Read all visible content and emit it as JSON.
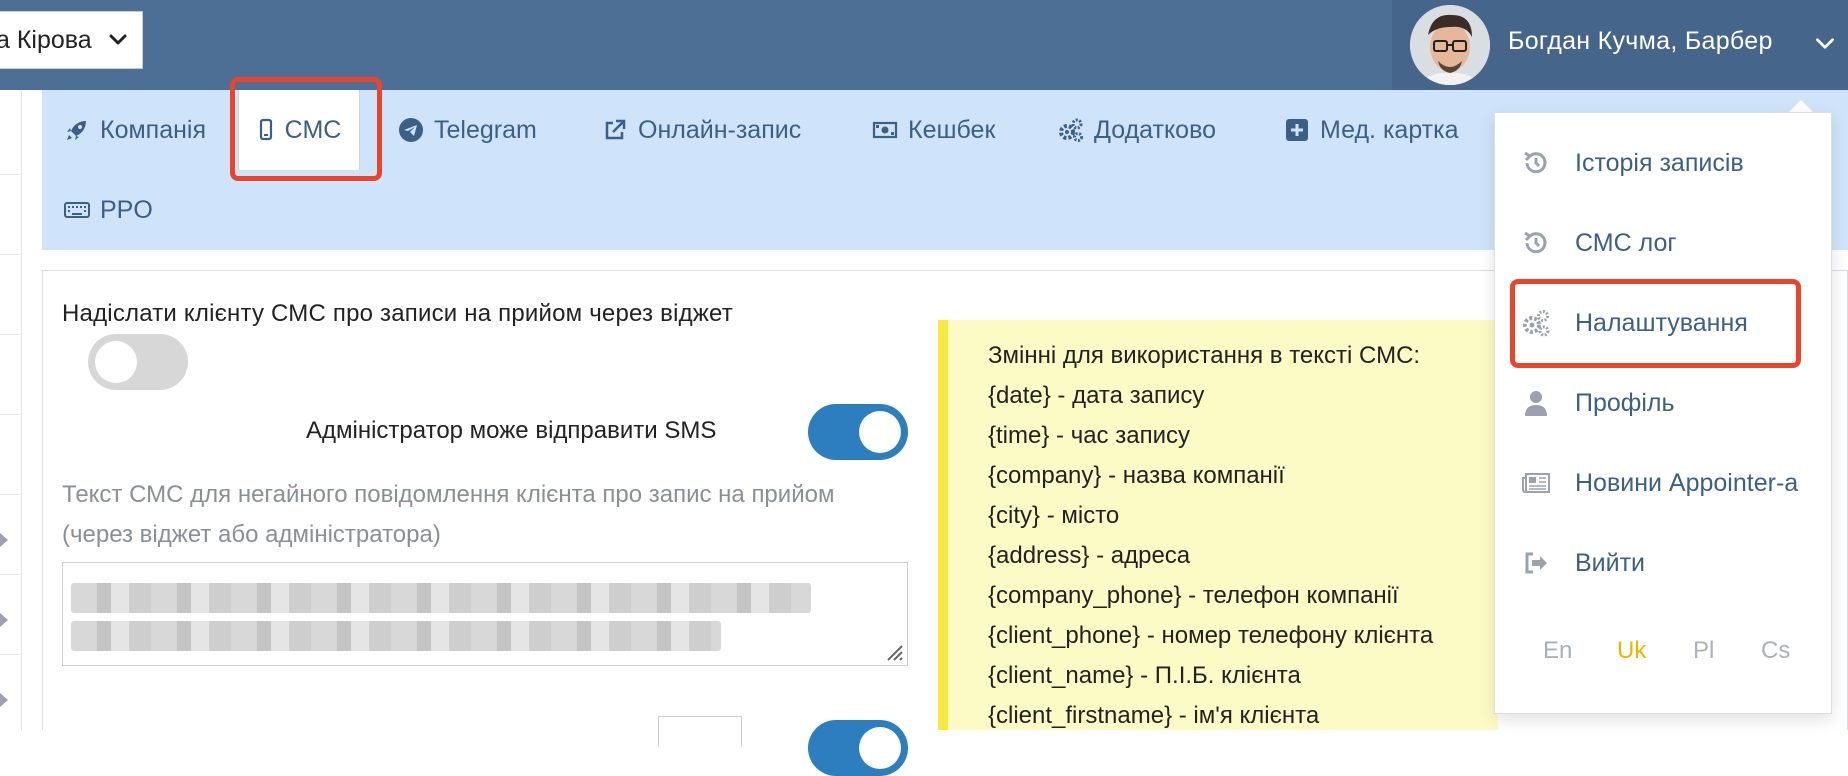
{
  "topbar": {
    "branch_select_value": "а Кірова",
    "user_name": "Богдан Кучма, Барбер"
  },
  "tabs": [
    {
      "label": "Компанія",
      "icon": "rocket-icon"
    },
    {
      "label": "СМС",
      "icon": "mobile-icon",
      "active": true
    },
    {
      "label": "Telegram",
      "icon": "telegram-icon"
    },
    {
      "label": "Онлайн-запис",
      "icon": "external-link-icon"
    },
    {
      "label": "Кешбек",
      "icon": "money-icon"
    },
    {
      "label": "Додатково",
      "icon": "gears-icon"
    },
    {
      "label": "Мед. картка",
      "icon": "plus-square-icon"
    },
    {
      "label": "PPO",
      "icon": "keyboard-icon"
    }
  ],
  "settings": {
    "send_widget_sms_label": "Надіслати клієнту СМС про записи на прийом через віджет",
    "send_widget_sms_enabled": false,
    "admin_can_send_label": "Адміністратор може відправити SMS",
    "admin_can_send_enabled": true,
    "sms_text_label": "Текст СМС для негайного повідомлення клієнта про запис на прийом (через віджет або адміністратора)"
  },
  "variables": {
    "title": "Змінні для використання в тексті СМС:",
    "items": [
      "{date} - дата запису",
      "{time} - час запису",
      "{company} - назва компанії",
      "{city} - місто",
      "{address} - адреса",
      "{company_phone} - телефон компанії",
      "{client_phone} - номер телефону клієнта",
      "{client_name} - П.І.Б. клієнта",
      "{client_firstname} - ім'я клієнта"
    ]
  },
  "user_menu": {
    "items": [
      {
        "label": "Історія записів",
        "icon": "history-icon"
      },
      {
        "label": "СМС лог",
        "icon": "history-icon"
      },
      {
        "label": "Налаштування",
        "icon": "gears-icon",
        "highlighted": true
      },
      {
        "label": "Профіль",
        "icon": "user-icon"
      },
      {
        "label": "Новини Appointer-a",
        "icon": "newspaper-icon"
      },
      {
        "label": "Вийти",
        "icon": "sign-out-icon"
      }
    ],
    "languages": [
      "En",
      "Uk",
      "Pl",
      "Cs"
    ],
    "active_language": "Uk"
  },
  "colors": {
    "header": "#4d6f96",
    "tabs_background": "#cfe4fb",
    "link": "#3c5f86",
    "highlight": "#e8452c",
    "toggle_on": "#2d7ebf",
    "note_background": "#fdfbc5",
    "note_border": "#f7e93f",
    "active_language": "#f0b400"
  }
}
